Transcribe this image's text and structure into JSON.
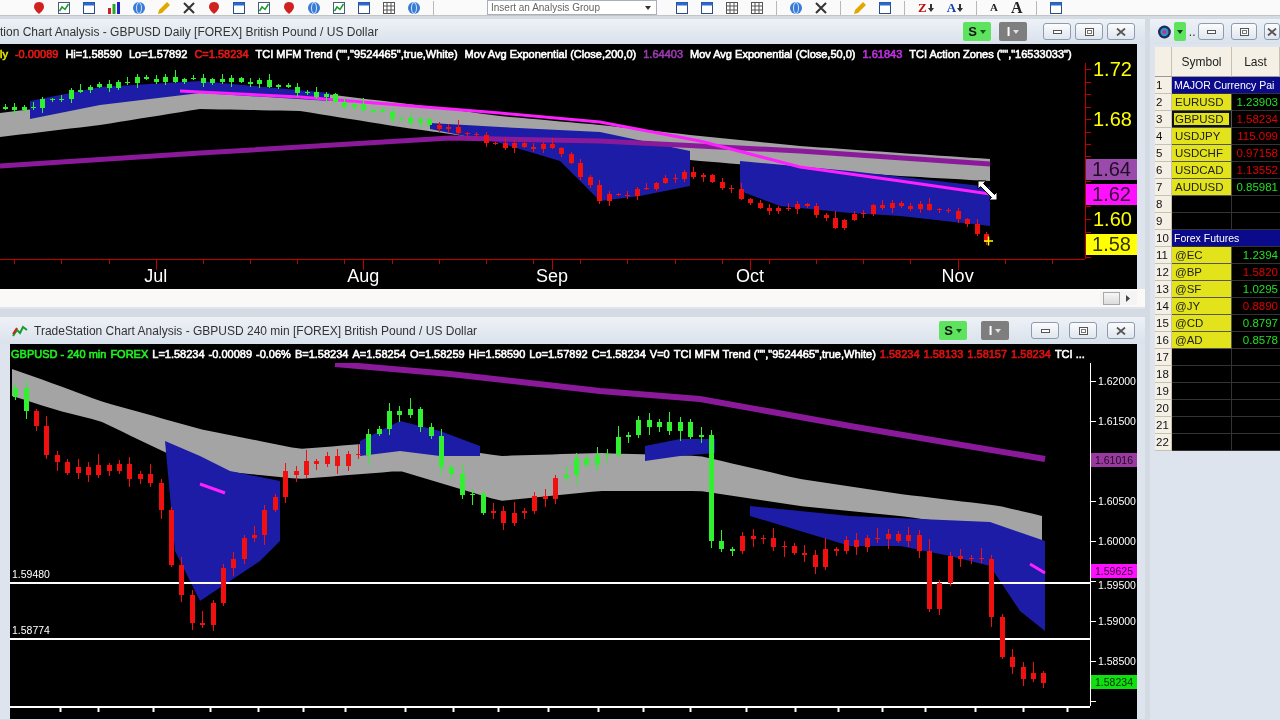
{
  "toolbar": {
    "analysis_group": {
      "placeholder": "Insert an Analysis Group"
    },
    "letter_tools": [
      {
        "text": "Z",
        "kind": "sort-descending"
      },
      {
        "text": "A",
        "kind": "sort-ascending"
      },
      {
        "text": "A",
        "kind": "small-font"
      },
      {
        "text": "A",
        "kind": "large-font"
      }
    ]
  },
  "daily_chart": {
    "title": "tion Chart Analysis - GBPUSD Daily [FOREX] British Pound / US Dollar",
    "style_button": "S",
    "indicator_button": "I",
    "status_items": [
      {
        "text": "ly",
        "color": "#e0e000"
      },
      {
        "text": "-0.00089",
        "color": "#e81818"
      },
      {
        "text": "Hi=1.58590",
        "color": "#ffffff"
      },
      {
        "text": "Lo=1.57892",
        "color": "#ffffff"
      },
      {
        "text": "C=1.58234",
        "color": "#e81818"
      },
      {
        "text": "TCI MFM Trend (\"\",\"9524465\",true,White)",
        "color": "#ffffff"
      },
      {
        "text": "Mov Avg Exponential (Close,200,0)",
        "color": "#ffffff"
      },
      {
        "text": "1.64403",
        "color": "#9a3ab0"
      },
      {
        "text": "Mov Avg Exponential (Close,50,0)",
        "color": "#ffffff"
      },
      {
        "text": "1.61843",
        "color": "#c030e0"
      },
      {
        "text": "TCI Action Zones (\"\",\"16533033\")",
        "color": "#ffffff"
      }
    ],
    "chart_data": {
      "type": "candlestick",
      "ylim": [
        1.568,
        1.7248
      ],
      "yticks": [
        {
          "value": 1.72,
          "label": "1.72"
        },
        {
          "value": 1.68,
          "label": "1.68"
        },
        {
          "value": 1.6,
          "label": "1.60"
        }
      ],
      "categories": [
        null,
        null,
        null,
        null,
        null,
        null,
        null,
        null,
        null,
        null,
        null,
        null,
        null,
        null,
        null,
        null,
        "Jul",
        null,
        null,
        null,
        null,
        null,
        null,
        null,
        null,
        null,
        null,
        null,
        null,
        null,
        null,
        null,
        null,
        null,
        null,
        null,
        null,
        null,
        "Aug",
        null,
        null,
        null,
        null,
        null,
        null,
        null,
        null,
        null,
        null,
        null,
        null,
        null,
        null,
        null,
        null,
        null,
        null,
        null,
        "Sep",
        null,
        null,
        null,
        null,
        null,
        null,
        null,
        null,
        null,
        null,
        null,
        null,
        null,
        null,
        null,
        null,
        null,
        null,
        null,
        null,
        "Oct",
        null,
        null,
        null,
        null,
        null,
        null,
        null,
        null,
        null,
        null,
        null,
        null,
        null,
        null,
        null,
        null,
        null,
        null,
        null,
        null,
        null,
        "Nov",
        null,
        null,
        null,
        null,
        null,
        null,
        null,
        null,
        null,
        null,
        null,
        null,
        null
      ],
      "ohlc": [
        [
          1.688,
          1.692,
          1.687,
          1.69
        ],
        [
          1.687,
          1.693,
          1.684,
          1.69
        ],
        [
          1.687,
          1.691,
          1.685,
          1.69
        ],
        [
          1.689,
          1.694,
          1.687,
          1.69
        ],
        [
          1.689,
          1.698,
          1.685,
          1.696
        ],
        [
          1.695,
          1.697,
          1.694,
          1.696
        ],
        [
          1.695,
          1.699,
          1.694,
          1.696
        ],
        [
          1.696,
          1.705,
          1.693,
          1.703
        ],
        [
          1.702,
          1.708,
          1.701,
          1.703
        ],
        [
          1.703,
          1.707,
          1.701,
          1.706
        ],
        [
          1.706,
          1.71,
          1.705,
          1.708
        ],
        [
          1.705,
          1.711,
          1.702,
          1.708
        ],
        [
          1.705,
          1.711,
          1.703,
          1.71
        ],
        [
          1.709,
          1.714,
          1.707,
          1.71
        ],
        [
          1.709,
          1.716,
          1.705,
          1.714
        ],
        [
          1.712,
          1.715,
          1.711,
          1.714
        ],
        [
          1.71,
          1.715,
          1.708,
          1.712
        ],
        [
          1.71,
          1.716,
          1.707,
          1.714
        ],
        [
          1.71,
          1.719,
          1.709,
          1.714
        ],
        [
          1.71,
          1.713,
          1.708,
          1.712
        ],
        [
          1.712,
          1.715,
          1.711,
          1.713
        ],
        [
          1.709,
          1.716,
          1.706,
          1.713
        ],
        [
          1.709,
          1.713,
          1.707,
          1.712
        ],
        [
          1.71,
          1.716,
          1.708,
          1.712
        ],
        [
          1.71,
          1.715,
          1.706,
          1.713
        ],
        [
          1.71,
          1.714,
          1.709,
          1.713
        ],
        [
          1.708,
          1.713,
          1.706,
          1.71
        ],
        [
          1.708,
          1.713,
          1.705,
          1.711
        ],
        [
          1.706,
          1.716,
          1.705,
          1.711
        ],
        [
          1.706,
          1.708,
          1.704,
          1.707
        ],
        [
          1.706,
          1.709,
          1.705,
          1.707
        ],
        [
          1.701,
          1.709,
          1.698,
          1.706
        ],
        [
          1.701,
          1.703,
          1.699,
          1.702
        ],
        [
          1.698,
          1.706,
          1.696,
          1.702
        ],
        [
          1.698,
          1.702,
          1.694,
          1.7
        ],
        [
          1.694,
          1.701,
          1.693,
          1.7
        ],
        [
          1.69,
          1.697,
          1.688,
          1.694
        ],
        [
          1.69,
          1.694,
          1.687,
          1.692
        ],
        [
          1.687,
          1.697,
          1.686,
          1.692
        ],
        [
          1.686,
          1.688,
          1.685,
          1.687
        ],
        [
          1.686,
          1.689,
          1.685,
          1.687
        ],
        [
          1.68,
          1.689,
          1.677,
          1.686
        ],
        [
          1.68,
          1.682,
          1.678,
          1.681
        ],
        [
          1.677,
          1.685,
          1.675,
          1.681
        ],
        [
          1.677,
          1.682,
          1.673,
          1.68
        ],
        [
          1.675,
          1.681,
          1.674,
          1.68
        ],
        [
          1.675,
          1.678,
          1.67,
          1.672
        ],
        [
          1.674,
          1.676,
          1.669,
          1.672
        ],
        [
          1.674,
          1.679,
          1.668,
          1.669
        ],
        [
          1.669,
          1.67,
          1.666,
          1.668
        ],
        [
          1.668,
          1.67,
          1.666,
          1.667
        ],
        [
          1.667,
          1.67,
          1.658,
          1.661
        ],
        [
          1.661,
          1.662,
          1.659,
          1.66
        ],
        [
          1.661,
          1.665,
          1.655,
          1.657
        ],
        [
          1.661,
          1.663,
          1.653,
          1.657
        ],
        [
          1.661,
          1.662,
          1.657,
          1.658
        ],
        [
          1.658,
          1.661,
          1.654,
          1.656
        ],
        [
          1.66,
          1.662,
          1.653,
          1.656
        ],
        [
          1.66,
          1.665,
          1.656,
          1.657
        ],
        [
          1.657,
          1.658,
          1.65,
          1.652
        ],
        [
          1.652,
          1.654,
          1.644,
          1.645
        ],
        [
          1.645,
          1.648,
          1.631,
          1.634
        ],
        [
          1.634,
          1.635,
          1.625,
          1.627
        ],
        [
          1.627,
          1.631,
          1.612,
          1.614
        ],
        [
          1.62,
          1.622,
          1.61,
          1.614
        ],
        [
          1.62,
          1.621,
          1.618,
          1.619
        ],
        [
          1.619,
          1.622,
          1.616,
          1.618
        ],
        [
          1.624,
          1.626,
          1.615,
          1.618
        ],
        [
          1.625,
          1.629,
          1.623,
          1.624
        ],
        [
          1.629,
          1.63,
          1.622,
          1.624
        ],
        [
          1.633,
          1.635,
          1.628,
          1.629
        ],
        [
          1.633,
          1.636,
          1.629,
          1.632
        ],
        [
          1.638,
          1.639,
          1.63,
          1.632
        ],
        [
          1.638,
          1.642,
          1.632,
          1.634
        ],
        [
          1.635,
          1.637,
          1.63,
          1.634
        ],
        [
          1.635,
          1.636,
          1.629,
          1.63
        ],
        [
          1.63,
          1.633,
          1.623,
          1.625
        ],
        [
          1.625,
          1.627,
          1.621,
          1.624
        ],
        [
          1.624,
          1.629,
          1.615,
          1.616
        ],
        [
          1.616,
          1.617,
          1.611,
          1.613
        ],
        [
          1.613,
          1.615,
          1.608,
          1.609
        ],
        [
          1.609,
          1.612,
          1.603,
          1.606
        ],
        [
          1.609,
          1.61,
          1.604,
          1.606
        ],
        [
          1.609,
          1.613,
          1.606,
          1.608
        ],
        [
          1.612,
          1.614,
          1.604,
          1.608
        ],
        [
          1.612,
          1.613,
          1.609,
          1.61
        ],
        [
          1.61,
          1.613,
          1.601,
          1.603
        ],
        [
          1.603,
          1.605,
          1.598,
          1.601
        ],
        [
          1.601,
          1.606,
          1.592,
          1.593
        ],
        [
          1.599,
          1.6,
          1.591,
          1.593
        ],
        [
          1.604,
          1.606,
          1.598,
          1.599
        ],
        [
          1.605,
          1.607,
          1.601,
          1.604
        ],
        [
          1.611,
          1.612,
          1.602,
          1.604
        ],
        [
          1.611,
          1.615,
          1.607,
          1.609
        ],
        [
          1.613,
          1.615,
          1.605,
          1.609
        ],
        [
          1.613,
          1.614,
          1.609,
          1.61
        ],
        [
          1.61,
          1.613,
          1.606,
          1.608
        ],
        [
          1.612,
          1.614,
          1.605,
          1.608
        ],
        [
          1.612,
          1.617,
          1.606,
          1.607
        ],
        [
          1.608,
          1.608,
          1.605,
          1.607
        ],
        [
          1.607,
          1.609,
          1.605,
          1.606
        ],
        [
          1.606,
          1.609,
          1.597,
          1.6
        ],
        [
          1.6,
          1.601,
          1.594,
          1.596
        ],
        [
          1.596,
          1.6,
          1.586,
          1.588
        ],
        [
          1.588,
          1.59,
          1.579,
          1.582
        ],
        null,
        null,
        null,
        null,
        null,
        null,
        null,
        null,
        null,
        null
      ]
    },
    "price_markers": [
      {
        "text": "1.64",
        "color": "#9a4aaa"
      },
      {
        "text": "1.62",
        "color": "#ff10ff"
      },
      {
        "text": "1.58",
        "color": "#ffff00"
      }
    ]
  },
  "intraday_chart": {
    "title": "TradeStation Chart Analysis - GBPUSD 240 min [FOREX] British Pound / US Dollar",
    "style_button": "S",
    "indicator_button": "I",
    "status_items": [
      {
        "text": "GBPUSD - 240 min",
        "color": "#20f020"
      },
      {
        "text": "FOREX",
        "color": "#20f020"
      },
      {
        "text": "L=1.58234",
        "color": "#ffffff"
      },
      {
        "text": "-0.00089",
        "color": "#ffffff"
      },
      {
        "text": "-0.06%",
        "color": "#ffffff"
      },
      {
        "text": "B=1.58234",
        "color": "#ffffff"
      },
      {
        "text": "A=1.58254",
        "color": "#ffffff"
      },
      {
        "text": "O=1.58259",
        "color": "#ffffff"
      },
      {
        "text": "Hi=1.58590",
        "color": "#ffffff"
      },
      {
        "text": "Lo=1.57892",
        "color": "#ffffff"
      },
      {
        "text": "C=1.58234",
        "color": "#ffffff"
      },
      {
        "text": "V=0",
        "color": "#ffffff"
      },
      {
        "text": "TCI MFM Trend (\"\",\"9524465\",true,White)",
        "color": "#ffffff"
      },
      {
        "text": "1.58234",
        "color": "#e01010"
      },
      {
        "text": "1.58133",
        "color": "#e01010"
      },
      {
        "text": "1.58157",
        "color": "#e01010"
      },
      {
        "text": "1.58234",
        "color": "#e01010"
      },
      {
        "text": "TCI ...",
        "color": "#ffffff"
      }
    ],
    "chart_data": {
      "type": "candlestick",
      "ylim": [
        1.579375,
        1.62225
      ],
      "yticks": [
        {
          "value": 1.62,
          "label": "1.62000"
        },
        {
          "value": 1.615,
          "label": "1.61500"
        },
        {
          "value": 1.605,
          "label": "1.60500"
        },
        {
          "value": 1.6,
          "label": "1.60000"
        },
        {
          "value": 1.595,
          "label": "1.59500"
        },
        {
          "value": 1.59,
          "label": "1.59000"
        },
        {
          "value": 1.585,
          "label": "1.58500"
        }
      ],
      "categories": [
        null,
        null,
        null,
        null,
        null,
        null,
        null,
        null,
        null,
        null,
        null,
        null,
        null,
        null,
        null,
        null,
        null,
        null,
        null,
        null,
        null,
        null,
        null,
        null,
        null,
        null,
        null,
        null,
        null,
        null,
        null,
        null,
        null,
        null,
        null,
        null,
        null,
        null,
        null,
        null,
        null,
        null,
        null,
        null,
        null,
        null,
        null,
        null,
        null,
        null,
        null,
        null,
        null,
        null,
        null,
        null,
        null,
        null,
        null,
        null,
        null,
        null,
        null,
        null,
        null,
        null,
        null,
        null,
        null,
        null,
        null,
        null,
        null,
        null,
        null,
        null,
        null,
        null,
        null,
        null,
        null,
        null,
        null,
        null,
        null,
        null,
        null,
        null,
        null,
        null,
        null,
        null,
        null,
        null,
        null,
        null,
        null,
        null,
        null,
        null,
        null,
        null,
        null,
        null
      ],
      "ohlc": [
        [
          1.618,
          1.6196,
          1.6176,
          1.6191
        ],
        [
          1.6162,
          1.62,
          1.6152,
          1.6191
        ],
        [
          1.6162,
          1.6165,
          1.6138,
          1.6144
        ],
        [
          1.6144,
          1.6156,
          1.6102,
          1.6107
        ],
        [
          1.6107,
          1.6113,
          1.6087,
          1.6099
        ],
        [
          1.6099,
          1.6103,
          1.6082,
          1.6085
        ],
        [
          1.6092,
          1.6102,
          1.6077,
          1.6085
        ],
        [
          1.6092,
          1.6099,
          1.6074,
          1.6083
        ],
        [
          1.6095,
          1.6109,
          1.6079,
          1.6083
        ],
        [
          1.6095,
          1.6098,
          1.6081,
          1.6088
        ],
        [
          1.6096,
          1.6101,
          1.6084,
          1.6088
        ],
        [
          1.6096,
          1.6105,
          1.6067,
          1.6077
        ],
        [
          1.6084,
          1.6087,
          1.6071,
          1.6077
        ],
        [
          1.6084,
          1.6096,
          1.6067,
          1.6072
        ],
        [
          1.6072,
          1.6078,
          1.6027,
          1.6039
        ],
        [
          1.6039,
          1.6043,
          1.5967,
          1.597
        ],
        [
          1.597,
          1.598,
          1.5924,
          1.5932
        ],
        [
          1.5932,
          1.5939,
          1.5889,
          1.5898
        ],
        [
          1.5898,
          1.5912,
          1.5891,
          1.5895
        ],
        [
          1.5923,
          1.5926,
          1.5888,
          1.5895
        ],
        [
          1.5966,
          1.5971,
          1.5919,
          1.5923
        ],
        [
          1.5977,
          1.5986,
          1.5956,
          1.5966
        ],
        [
          1.6004,
          1.6007,
          1.5971,
          1.5977
        ],
        [
          1.6007,
          1.6019,
          1.5999,
          1.6004
        ],
        [
          1.6039,
          1.6045,
          1.5995,
          1.6007
        ],
        [
          1.6055,
          1.6059,
          1.6036,
          1.6039
        ],
        [
          1.6087,
          1.6097,
          1.6047,
          1.6055
        ],
        [
          1.6087,
          1.6094,
          1.6074,
          1.6083
        ],
        [
          1.61,
          1.6114,
          1.6079,
          1.6083
        ],
        [
          1.61,
          1.6103,
          1.6089,
          1.6096
        ],
        [
          1.6106,
          1.6111,
          1.6092,
          1.6096
        ],
        [
          1.6106,
          1.6115,
          1.6084,
          1.6094
        ],
        [
          1.6109,
          1.6112,
          1.6088,
          1.6094
        ],
        [
          1.6109,
          1.6121,
          1.6102,
          1.6107
        ],
        [
          1.6107,
          1.614,
          1.6095,
          1.6134
        ],
        [
          1.6134,
          1.6144,
          1.6131,
          1.614
        ],
        [
          1.614,
          1.6172,
          1.6132,
          1.6162
        ],
        [
          1.6158,
          1.6169,
          1.6149,
          1.6162
        ],
        [
          1.6158,
          1.6179,
          1.6154,
          1.6165
        ],
        [
          1.6143,
          1.6168,
          1.6136,
          1.6165
        ],
        [
          1.6131,
          1.6148,
          1.6127,
          1.6143
        ],
        [
          1.6092,
          1.614,
          1.6082,
          1.6131
        ],
        [
          1.6084,
          1.6095,
          1.6078,
          1.6092
        ],
        [
          1.6057,
          1.6096,
          1.6052,
          1.6084
        ],
        [
          1.6057,
          1.6065,
          1.6045,
          1.6059
        ],
        [
          1.6035,
          1.6063,
          1.6032,
          1.6059
        ],
        [
          1.6037,
          1.6047,
          1.6027,
          1.6035
        ],
        [
          1.6037,
          1.6044,
          1.6014,
          1.6023
        ],
        [
          1.6035,
          1.6049,
          1.6019,
          1.6023
        ],
        [
          1.6038,
          1.6041,
          1.6028,
          1.6035
        ],
        [
          1.6056,
          1.6061,
          1.6034,
          1.6038
        ],
        [
          1.6056,
          1.6065,
          1.6042,
          1.6052
        ],
        [
          1.6079,
          1.6082,
          1.6046,
          1.6052
        ],
        [
          1.6079,
          1.6094,
          1.6074,
          1.6082
        ],
        [
          1.6082,
          1.611,
          1.607,
          1.6104
        ],
        [
          1.6095,
          1.6108,
          1.6092,
          1.6104
        ],
        [
          1.6095,
          1.6117,
          1.6087,
          1.6107
        ],
        [
          1.6107,
          1.6115,
          1.6098,
          1.6108
        ],
        [
          1.6108,
          1.6144,
          1.6104,
          1.613
        ],
        [
          1.613,
          1.6136,
          1.6123,
          1.6133
        ],
        [
          1.6133,
          1.6156,
          1.6129,
          1.6151
        ],
        [
          1.6142,
          1.616,
          1.6132,
          1.6151
        ],
        [
          1.6142,
          1.6152,
          1.6136,
          1.6149
        ],
        [
          1.6137,
          1.6161,
          1.6132,
          1.6149
        ],
        [
          1.6137,
          1.6155,
          1.6125,
          1.6149
        ],
        [
          1.613,
          1.6153,
          1.6127,
          1.6149
        ],
        [
          1.613,
          1.6142,
          1.6122,
          1.6132
        ],
        [
          1.6,
          1.6139,
          1.5991,
          1.6132
        ],
        [
          1.599,
          1.6014,
          1.5986,
          1.6
        ],
        [
          1.5988,
          1.5993,
          1.5981,
          1.599
        ],
        [
          1.6006,
          1.6011,
          1.5984,
          1.5988
        ],
        [
          1.6006,
          1.6015,
          1.5992,
          1.6002
        ],
        [
          1.6004,
          1.6007,
          1.5996,
          1.6002
        ],
        [
          1.6004,
          1.6016,
          1.5987,
          1.5992
        ],
        [
          1.5994,
          1.6,
          1.598,
          1.5992
        ],
        [
          1.5994,
          1.5998,
          1.5982,
          1.5985
        ],
        [
          1.5985,
          1.5995,
          1.5974,
          1.5982
        ],
        [
          1.5982,
          1.5989,
          1.5959,
          1.5968
        ],
        [
          1.599,
          1.6004,
          1.5964,
          1.5968
        ],
        [
          1.599,
          1.5993,
          1.5981,
          1.5988
        ],
        [
          1.6001,
          1.6006,
          1.5984,
          1.5988
        ],
        [
          1.6001,
          1.601,
          1.5982,
          1.5992
        ],
        [
          1.6004,
          1.6007,
          1.5986,
          1.5992
        ],
        [
          1.6004,
          1.6016,
          1.5997,
          1.6002
        ],
        [
          1.6009,
          1.6015,
          1.599,
          1.6002
        ],
        [
          1.6009,
          1.6013,
          1.5997,
          1.6
        ],
        [
          1.6007,
          1.6017,
          1.5992,
          1.6
        ],
        [
          1.6007,
          1.6014,
          1.5979,
          1.5988
        ],
        [
          1.5988,
          1.6002,
          1.5911,
          1.5915
        ],
        [
          1.5948,
          1.5951,
          1.5908,
          1.5915
        ],
        [
          1.5981,
          1.5986,
          1.5944,
          1.5948
        ],
        [
          1.5981,
          1.599,
          1.5967,
          1.5977
        ],
        [
          1.5979,
          1.5982,
          1.5971,
          1.5977
        ],
        [
          1.5979,
          1.5991,
          1.5972,
          1.5977
        ],
        [
          1.5977,
          1.5983,
          1.5893,
          1.5905
        ],
        [
          1.5905,
          1.5909,
          1.5852,
          1.5855
        ],
        [
          1.5855,
          1.5865,
          1.5834,
          1.5842
        ],
        [
          1.5842,
          1.5849,
          1.5819,
          1.5828
        ],
        [
          1.5835,
          1.5849,
          1.5824,
          1.5828
        ],
        [
          1.5835,
          1.5838,
          1.5816,
          1.5823
        ],
        null,
        null,
        null,
        null
      ]
    },
    "price_markers": [
      {
        "text": "1.61016",
        "color": "#9a3aa0"
      },
      {
        "text": "1.59625",
        "color": "#ff10ff"
      },
      {
        "text": "1.58234",
        "color": "#10e010"
      }
    ],
    "level_lines": [
      "1.59480",
      "1.58774"
    ]
  },
  "watchlist": {
    "title": "..",
    "columns": [
      "Symbol",
      "Last"
    ],
    "rows": [
      {
        "number": "1",
        "kind": "group",
        "label": "MAJOR Currency Pai",
        "selected": false
      },
      {
        "number": "2",
        "kind": "symbol",
        "symbol": "EURUSD",
        "last": "1.23903",
        "color": "#20e020",
        "selected": false
      },
      {
        "number": "3",
        "kind": "symbol",
        "symbol": "GBPUSD",
        "last": "1.58234",
        "color": "#e00000",
        "selected": true
      },
      {
        "number": "4",
        "kind": "symbol",
        "symbol": "USDJPY",
        "last": "115.099",
        "color": "#e00000",
        "selected": false
      },
      {
        "number": "5",
        "kind": "symbol",
        "symbol": "USDCHF",
        "last": "0.97158",
        "color": "#e00000",
        "selected": false
      },
      {
        "number": "6",
        "kind": "symbol",
        "symbol": "USDCAD",
        "last": "1.13552",
        "color": "#e00000",
        "selected": false
      },
      {
        "number": "7",
        "kind": "symbol",
        "symbol": "AUDUSD",
        "last": "0.85981",
        "color": "#20e020",
        "selected": false
      },
      {
        "number": "8",
        "kind": "empty",
        "selected": false
      },
      {
        "number": "9",
        "kind": "empty",
        "selected": false
      },
      {
        "number": "10",
        "kind": "group",
        "label": "Forex Futures",
        "selected": false
      },
      {
        "number": "11",
        "kind": "symbol",
        "symbol": "@EC",
        "last": "1.2394",
        "color": "#20e020",
        "selected": false
      },
      {
        "number": "12",
        "kind": "symbol",
        "symbol": "@BP",
        "last": "1.5820",
        "color": "#e00000",
        "selected": false
      },
      {
        "number": "13",
        "kind": "symbol",
        "symbol": "@SF",
        "last": "1.0295",
        "color": "#20e020",
        "selected": false
      },
      {
        "number": "14",
        "kind": "symbol",
        "symbol": "@JY",
        "last": "0.8890",
        "color": "#e00000",
        "selected": false
      },
      {
        "number": "15",
        "kind": "symbol",
        "symbol": "@CD",
        "last": "0.8797",
        "color": "#20e020",
        "selected": false
      },
      {
        "number": "16",
        "kind": "symbol",
        "symbol": "@AD",
        "last": "0.8578",
        "color": "#20e020",
        "selected": false
      },
      {
        "number": "17",
        "kind": "empty",
        "selected": false
      },
      {
        "number": "18",
        "kind": "empty",
        "selected": false
      },
      {
        "number": "19",
        "kind": "empty",
        "selected": false
      },
      {
        "number": "20",
        "kind": "empty",
        "selected": false
      },
      {
        "number": "21",
        "kind": "empty",
        "selected": false
      },
      {
        "number": "22",
        "kind": "empty",
        "selected": false
      }
    ]
  }
}
